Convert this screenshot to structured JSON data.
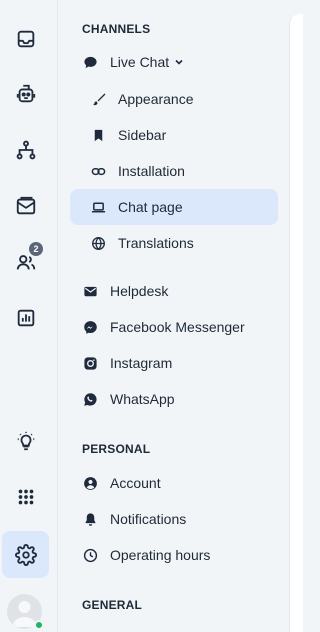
{
  "rail": {
    "items": [
      {
        "icon": "inbox-icon"
      },
      {
        "icon": "bot-icon"
      },
      {
        "icon": "flow-icon"
      },
      {
        "icon": "mail-icon"
      },
      {
        "icon": "contacts-icon",
        "badge": "2"
      },
      {
        "icon": "analytics-icon"
      },
      {
        "icon": "lightbulb-icon"
      },
      {
        "icon": "apps-grid-icon"
      },
      {
        "icon": "settings-gear-icon",
        "active": true
      }
    ]
  },
  "channels": {
    "heading": "CHANNELS",
    "live_chat": "Live Chat",
    "appearance": "Appearance",
    "sidebar": "Sidebar",
    "installation": "Installation",
    "chat_page": "Chat page",
    "translations": "Translations",
    "helpdesk": "Helpdesk",
    "facebook": "Facebook Messenger",
    "instagram": "Instagram",
    "whatsapp": "WhatsApp"
  },
  "personal": {
    "heading": "PERSONAL",
    "account": "Account",
    "notifications": "Notifications",
    "operating_hours": "Operating hours"
  },
  "general": {
    "heading": "GENERAL"
  },
  "colors": {
    "active_bg": "#dbe7fb",
    "online": "#1fb463"
  }
}
